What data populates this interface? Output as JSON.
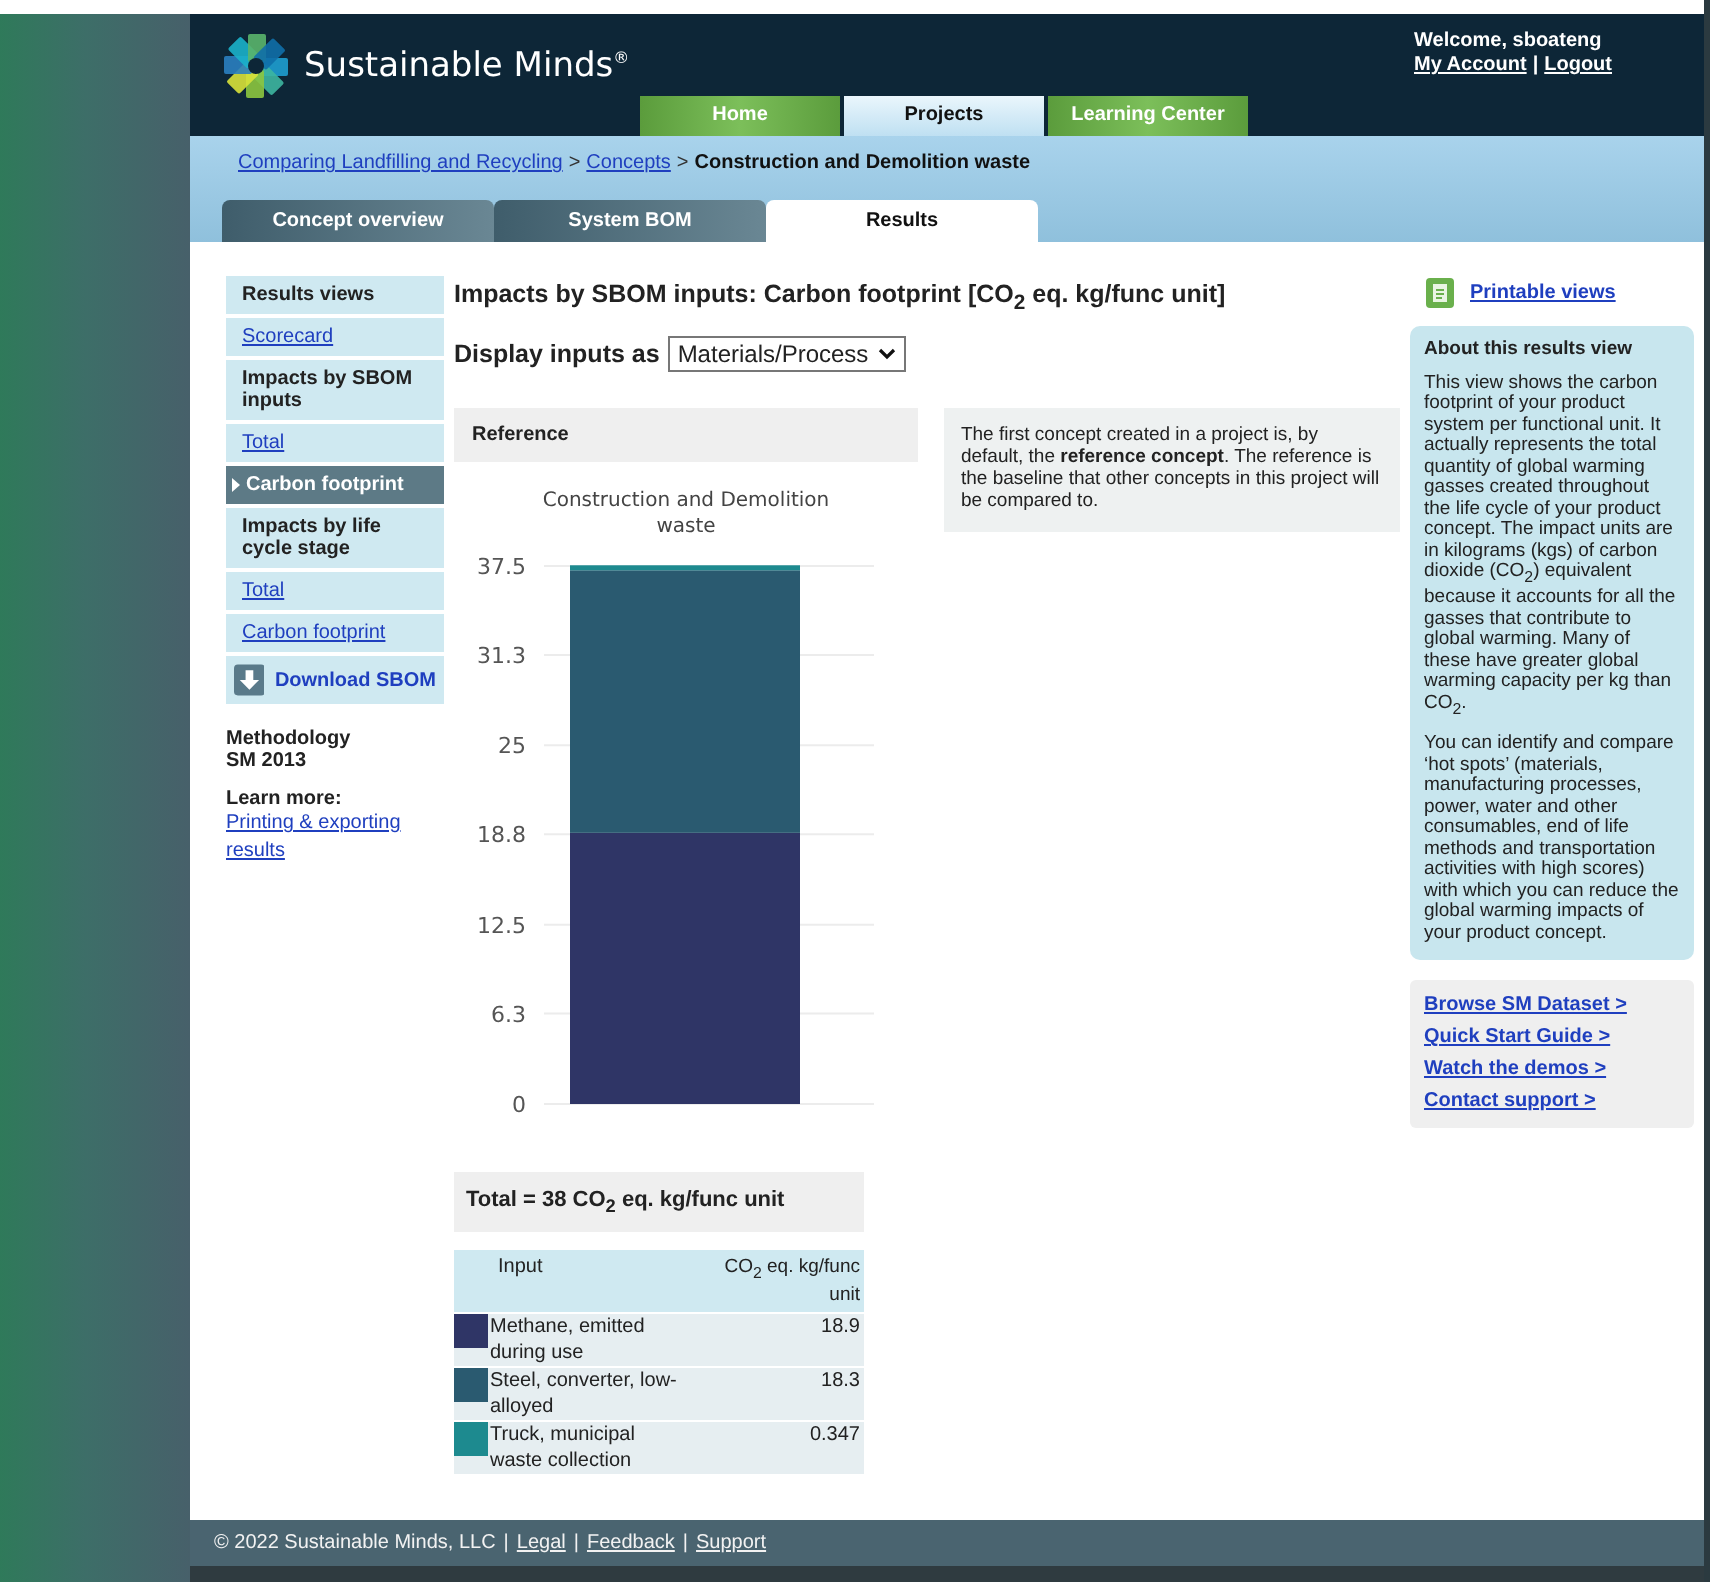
{
  "header": {
    "logo_text": "Sustainable Minds$^{®}$",
    "welcome": "Welcome, sboateng",
    "account_links": [
      {
        "text": "My Account",
        "kind": "link"
      },
      {
        "text": "|",
        "kind": "separator"
      },
      {
        "text": "Logout",
        "kind": "link"
      }
    ]
  },
  "main_tabs": [
    {
      "label": "Home",
      "selected": false
    },
    {
      "label": "Projects",
      "selected": true
    },
    {
      "label": "Learning Center",
      "selected": false
    }
  ],
  "breadcrumb": [
    {
      "text": "Comparing Landfilling and Recycling",
      "kind": "link"
    },
    {
      "text": ">",
      "kind": "separator"
    },
    {
      "text": "Concepts",
      "kind": "link"
    },
    {
      "text": ">",
      "kind": "separator"
    },
    {
      "text": "Construction and Demolition waste",
      "kind": "current"
    }
  ],
  "sub_tabs": [
    {
      "label": "Concept overview",
      "selected": false
    },
    {
      "label": "System BOM",
      "selected": false
    },
    {
      "label": "Results",
      "selected": true
    }
  ],
  "sidebar": {
    "items": [
      {
        "label": "Results views",
        "kind": "heading"
      },
      {
        "label": "Scorecard",
        "kind": "link",
        "selected": false
      },
      {
        "label": "Impacts by SBOM inputs",
        "kind": "heading"
      },
      {
        "label": "Total",
        "kind": "link",
        "selected": false
      },
      {
        "label": "Carbon footprint",
        "kind": "link",
        "selected": true
      },
      {
        "label": "Impacts by life cycle stage",
        "kind": "heading"
      },
      {
        "label": "Total",
        "kind": "link",
        "selected": false
      },
      {
        "label": "Carbon footprint",
        "kind": "link",
        "selected": false
      }
    ],
    "download_button": "Download SBOM",
    "methodology_label": "Methodology",
    "methodology_value": "SM 2013",
    "learn_more_label": "Learn more:",
    "learn_more_link": "Printing & exporting results"
  },
  "main": {
    "title": "Impacts by SBOM inputs: Carbon footprint [CO$_{2}$ eq. kg/func unit]",
    "display_label": "Display inputs as",
    "display_value": "Materials/Process",
    "reference_heading": "Reference",
    "reference_note": "The first concept created in a project is, by default, the **reference concept**. The reference is the baseline that other concepts in this project will be compared to.",
    "chart_data": {
      "type": "bar",
      "stacked": true,
      "grid": true,
      "title": "Construction and Demolition waste",
      "ylim": [
        0,
        37.5
      ],
      "yticks": [
        0,
        6.3,
        12.5,
        18.8,
        25,
        31.3,
        37.5
      ],
      "series": [
        {
          "name": "Methane, emitted during use",
          "color": "#2f3566",
          "values": [
            18.9
          ]
        },
        {
          "name": "Steel, converter, low-alloyed",
          "color": "#2a5a70",
          "values": [
            18.3
          ]
        },
        {
          "name": "Truck, municipal waste collection",
          "color": "#1d8a8f",
          "values": [
            0.35
          ]
        }
      ]
    },
    "total": "Total = 38 CO$_{2}$ eq. kg/func unit",
    "legend_table": {
      "columns": [
        "Input",
        "CO$_{2}$ eq. kg/func unit"
      ],
      "values": [
        "18.9",
        "18.3",
        "0.347"
      ]
    }
  },
  "right_panel": {
    "printable_link": "Printable views",
    "about_title": "About this results view",
    "about_paragraphs": [
      "This view shows the carbon footprint of your product system per functional unit. It actually represents the total quantity of global warming gasses created throughout the life cycle of your product concept. The impact units are in kilograms (kgs) of carbon dioxide (CO$_{2}$) equivalent because it accounts for all the gasses that contribute to global warming. Many of these have greater global warming capacity per kg than CO$_{2}$.",
      "You can identify and compare ‘hot spots’ (materials, manufacturing processes, power, water and other consumables, end of life methods and transportation activities with high scores) with which you can reduce the global warming impacts of your product concept."
    ],
    "links": [
      "Browse SM Dataset >",
      "Quick Start Guide >",
      "Watch the demos >",
      "Contact support >"
    ]
  },
  "footer": [
    {
      "text": "© 2022 Sustainable Minds, LLC",
      "kind": "text"
    },
    {
      "text": "|",
      "kind": "separator"
    },
    {
      "text": "Legal",
      "kind": "link"
    },
    {
      "text": "|",
      "kind": "separator"
    },
    {
      "text": "Feedback",
      "kind": "link"
    },
    {
      "text": "|",
      "kind": "separator"
    },
    {
      "text": "Support",
      "kind": "link"
    }
  ]
}
